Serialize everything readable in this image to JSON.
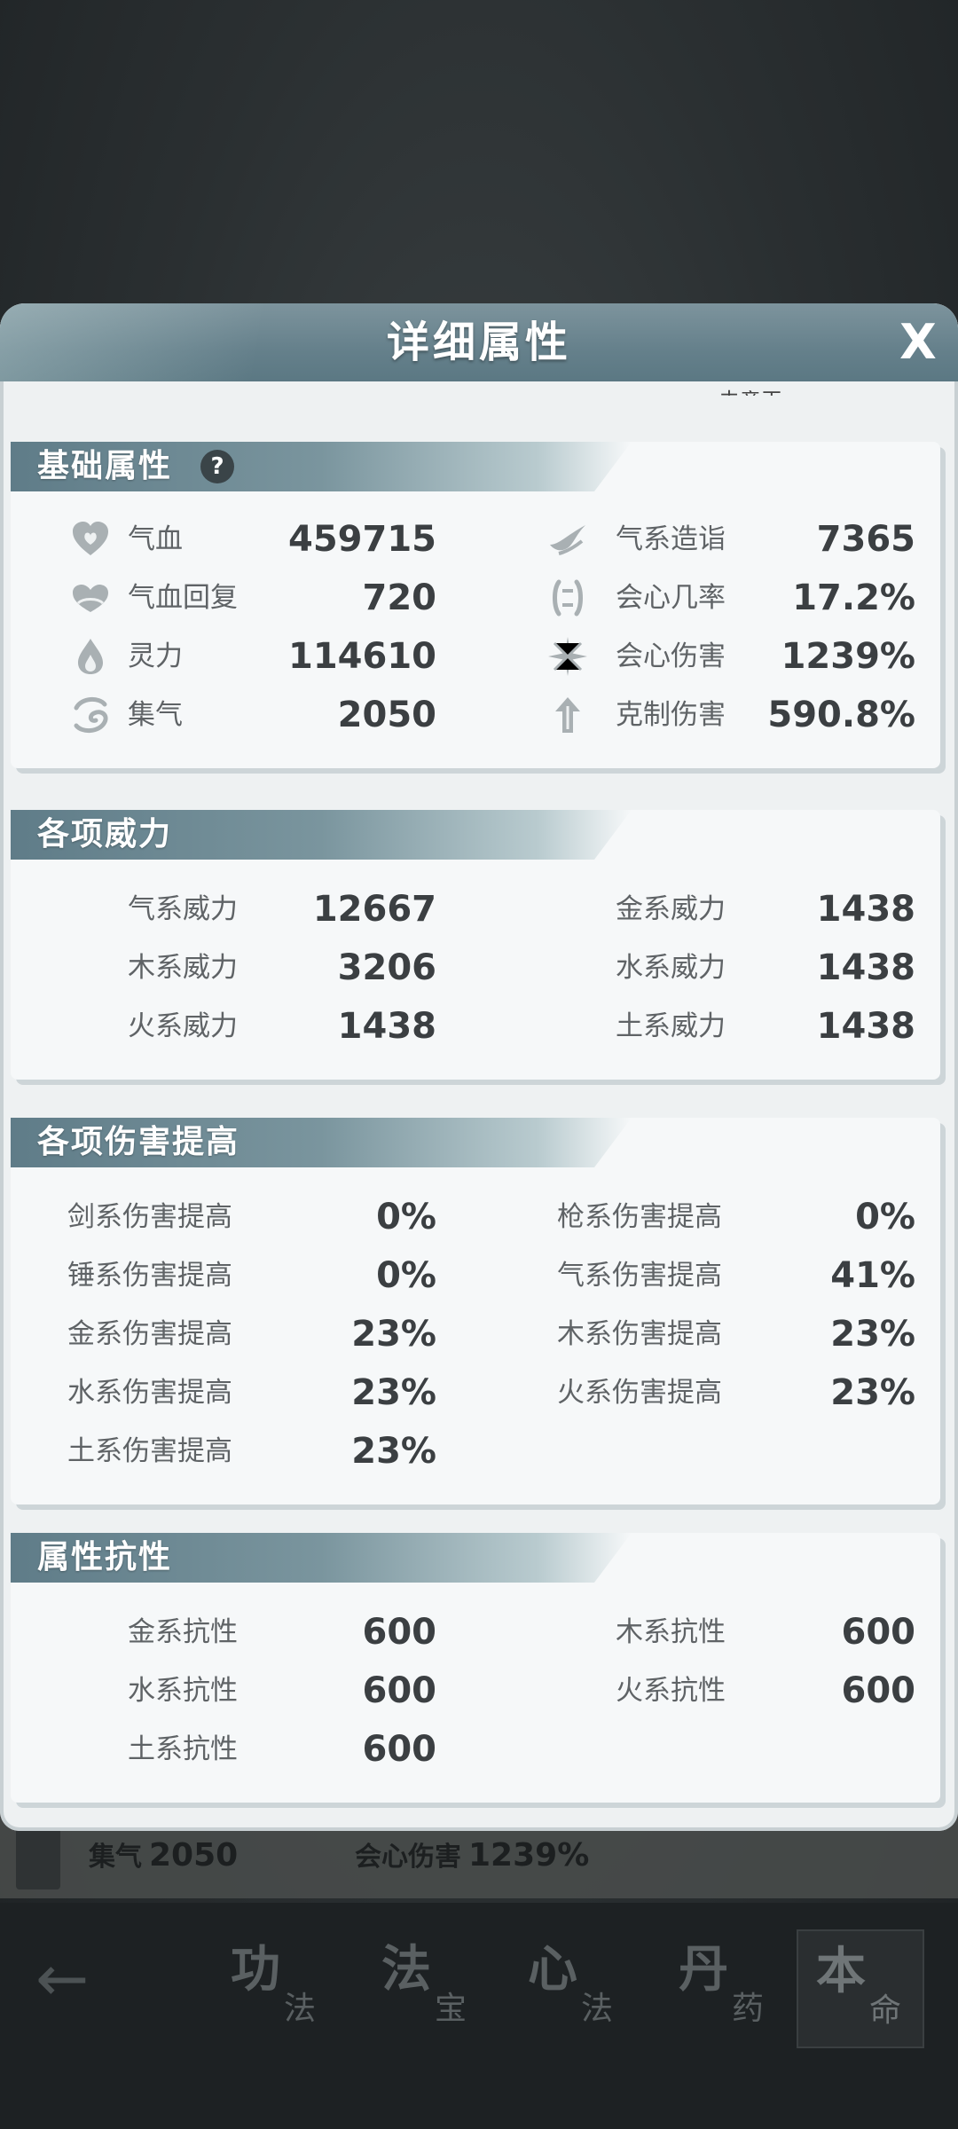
{
  "dialog": {
    "title": "详细属性",
    "close_glyph": "X",
    "cut_text": "未竟玉"
  },
  "sections": {
    "basic": {
      "title": "基础属性",
      "help_glyph": "?",
      "left": [
        {
          "icon": "heart-icon",
          "label": "气血",
          "value": "459715"
        },
        {
          "icon": "heart-regen-icon",
          "label": "气血回复",
          "value": "720"
        },
        {
          "icon": "flame-drop-icon",
          "label": "灵力",
          "value": "114610"
        },
        {
          "icon": "swirl-icon",
          "label": "集气",
          "value": "2050"
        }
      ],
      "right": [
        {
          "icon": "wing-icon",
          "label": "气系造诣",
          "value": "7365"
        },
        {
          "icon": "crit-rate-icon",
          "label": "会心几率",
          "value": "17.2%"
        },
        {
          "icon": "starburst-icon",
          "label": "会心伤害",
          "value": "1239%"
        },
        {
          "icon": "arrow-up-icon",
          "label": "克制伤害",
          "value": "590.8%"
        }
      ]
    },
    "power": {
      "title": "各项威力",
      "left": [
        {
          "label": "气系威力",
          "value": "12667"
        },
        {
          "label": "木系威力",
          "value": "3206"
        },
        {
          "label": "火系威力",
          "value": "1438"
        }
      ],
      "right": [
        {
          "label": "金系威力",
          "value": "1438"
        },
        {
          "label": "水系威力",
          "value": "1438"
        },
        {
          "label": "土系威力",
          "value": "1438"
        }
      ]
    },
    "damage": {
      "title": "各项伤害提高",
      "left": [
        {
          "label": "剑系伤害提高",
          "value": "0%"
        },
        {
          "label": "锤系伤害提高",
          "value": "0%"
        },
        {
          "label": "金系伤害提高",
          "value": "23%"
        },
        {
          "label": "水系伤害提高",
          "value": "23%"
        },
        {
          "label": "土系伤害提高",
          "value": "23%"
        }
      ],
      "right": [
        {
          "label": "枪系伤害提高",
          "value": "0%"
        },
        {
          "label": "气系伤害提高",
          "value": "41%"
        },
        {
          "label": "木系伤害提高",
          "value": "23%"
        },
        {
          "label": "火系伤害提高",
          "value": "23%"
        }
      ]
    },
    "resist": {
      "title": "属性抗性",
      "left": [
        {
          "label": "金系抗性",
          "value": "600"
        },
        {
          "label": "水系抗性",
          "value": "600"
        },
        {
          "label": "土系抗性",
          "value": "600"
        }
      ],
      "right": [
        {
          "label": "木系抗性",
          "value": "600"
        },
        {
          "label": "火系抗性",
          "value": "600"
        }
      ]
    }
  },
  "background": {
    "stat_left_label": "集气",
    "stat_left_value": "2050",
    "stat_right_label": "会心伤害",
    "stat_right_value": "1239%"
  },
  "bottom_nav": {
    "back_glyph": "←",
    "items": [
      {
        "big": "功",
        "small": "法"
      },
      {
        "big": "法",
        "small": "宝"
      },
      {
        "big": "心",
        "small": "法"
      },
      {
        "big": "丹",
        "small": "药"
      },
      {
        "big": "本",
        "small": "命"
      }
    ]
  }
}
